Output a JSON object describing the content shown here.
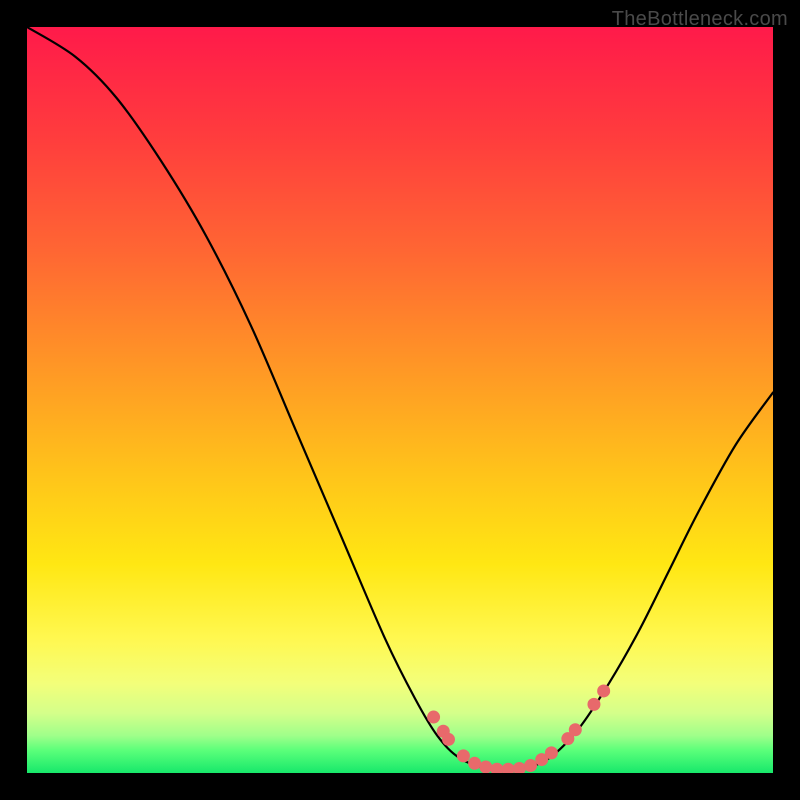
{
  "watermark": "TheBottleneck.com",
  "chart_data": {
    "type": "line",
    "title": "",
    "xlabel": "",
    "ylabel": "",
    "xlim": [
      0,
      100
    ],
    "ylim": [
      0,
      100
    ],
    "grid": false,
    "legend": false,
    "curve_points": [
      {
        "x": 0,
        "y": 100
      },
      {
        "x": 6.5,
        "y": 96
      },
      {
        "x": 12,
        "y": 90.5
      },
      {
        "x": 18,
        "y": 82
      },
      {
        "x": 24,
        "y": 72
      },
      {
        "x": 30,
        "y": 60
      },
      {
        "x": 36,
        "y": 46
      },
      {
        "x": 42,
        "y": 32
      },
      {
        "x": 48,
        "y": 18
      },
      {
        "x": 52,
        "y": 10
      },
      {
        "x": 55,
        "y": 5
      },
      {
        "x": 58,
        "y": 2
      },
      {
        "x": 62,
        "y": 0.5
      },
      {
        "x": 66,
        "y": 0.5
      },
      {
        "x": 70,
        "y": 2
      },
      {
        "x": 74,
        "y": 6
      },
      {
        "x": 78,
        "y": 12
      },
      {
        "x": 82,
        "y": 19
      },
      {
        "x": 86,
        "y": 27
      },
      {
        "x": 90,
        "y": 35
      },
      {
        "x": 95,
        "y": 44
      },
      {
        "x": 100,
        "y": 51
      }
    ],
    "marker_points": [
      {
        "x": 54.5,
        "y": 7.5
      },
      {
        "x": 55.8,
        "y": 5.6
      },
      {
        "x": 56.5,
        "y": 4.5
      },
      {
        "x": 58.5,
        "y": 2.3
      },
      {
        "x": 60,
        "y": 1.3
      },
      {
        "x": 61.5,
        "y": 0.8
      },
      {
        "x": 63,
        "y": 0.5
      },
      {
        "x": 64.5,
        "y": 0.5
      },
      {
        "x": 66,
        "y": 0.6
      },
      {
        "x": 67.5,
        "y": 1.0
      },
      {
        "x": 69,
        "y": 1.8
      },
      {
        "x": 70.3,
        "y": 2.7
      },
      {
        "x": 72.5,
        "y": 4.6
      },
      {
        "x": 73.5,
        "y": 5.8
      },
      {
        "x": 76,
        "y": 9.2
      },
      {
        "x": 77.3,
        "y": 11.0
      }
    ],
    "gradient_stops": [
      {
        "offset": 0,
        "color": "#ff1a4a"
      },
      {
        "offset": 15,
        "color": "#ff3d3d"
      },
      {
        "offset": 30,
        "color": "#ff6633"
      },
      {
        "offset": 45,
        "color": "#ff9526"
      },
      {
        "offset": 60,
        "color": "#ffc41a"
      },
      {
        "offset": 72,
        "color": "#ffe713"
      },
      {
        "offset": 82,
        "color": "#fff850"
      },
      {
        "offset": 88,
        "color": "#f3ff7a"
      },
      {
        "offset": 92,
        "color": "#d4ff8a"
      },
      {
        "offset": 95,
        "color": "#9fff8a"
      },
      {
        "offset": 97,
        "color": "#5aff7a"
      },
      {
        "offset": 100,
        "color": "#17e86b"
      }
    ],
    "marker_color": "#e8696b",
    "curve_color": "#000000"
  }
}
